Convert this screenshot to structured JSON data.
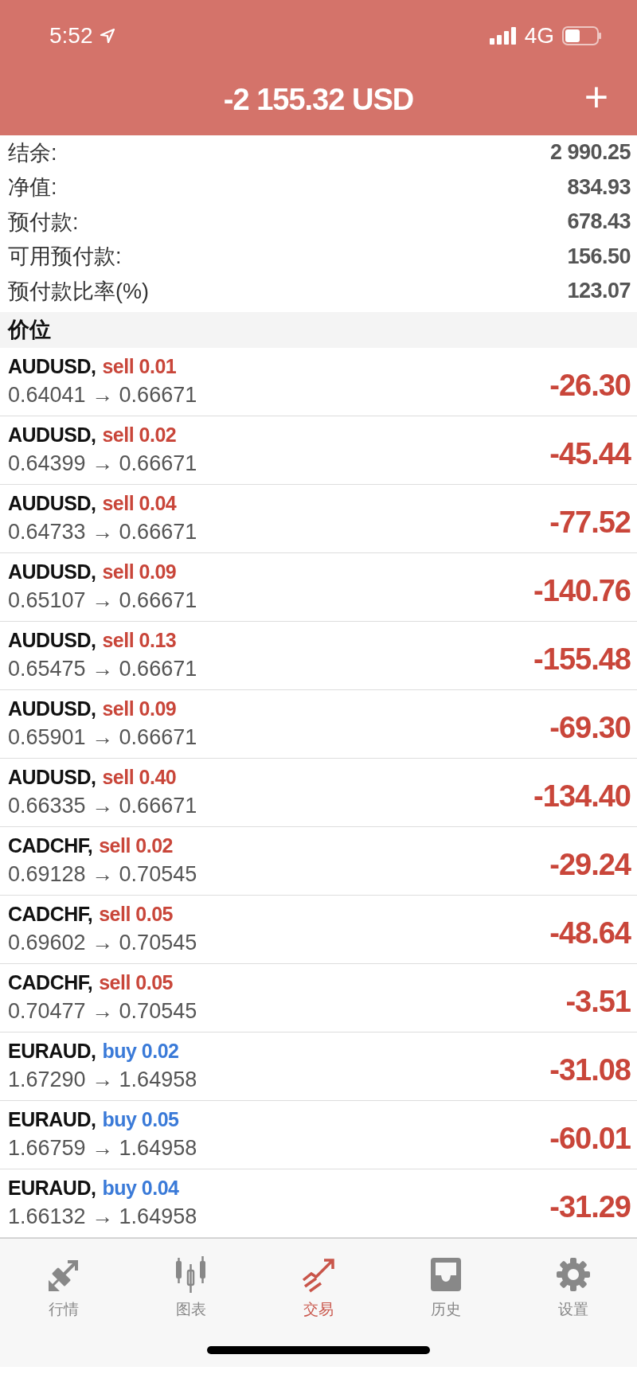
{
  "status_bar": {
    "time": "5:52",
    "network": "4G"
  },
  "header": {
    "title": "-2 155.32 USD",
    "add_button": "+"
  },
  "summary": [
    {
      "label": "结余:",
      "value": "2 990.25"
    },
    {
      "label": "净值:",
      "value": "834.93"
    },
    {
      "label": "预付款:",
      "value": "678.43"
    },
    {
      "label": "可用预付款:",
      "value": "156.50"
    },
    {
      "label": "预付款比率(%)",
      "value": "123.07"
    }
  ],
  "section_title": "价位",
  "positions": [
    {
      "symbol": "AUDUSD,",
      "kind": "sell",
      "order": "sell 0.01",
      "prices": "0.64041 → 0.66671",
      "profit": "-26.30"
    },
    {
      "symbol": "AUDUSD,",
      "kind": "sell",
      "order": "sell 0.02",
      "prices": "0.64399 → 0.66671",
      "profit": "-45.44"
    },
    {
      "symbol": "AUDUSD,",
      "kind": "sell",
      "order": "sell 0.04",
      "prices": "0.64733 → 0.66671",
      "profit": "-77.52"
    },
    {
      "symbol": "AUDUSD,",
      "kind": "sell",
      "order": "sell 0.09",
      "prices": "0.65107 → 0.66671",
      "profit": "-140.76"
    },
    {
      "symbol": "AUDUSD,",
      "kind": "sell",
      "order": "sell 0.13",
      "prices": "0.65475 → 0.66671",
      "profit": "-155.48"
    },
    {
      "symbol": "AUDUSD,",
      "kind": "sell",
      "order": "sell 0.09",
      "prices": "0.65901 → 0.66671",
      "profit": "-69.30"
    },
    {
      "symbol": "AUDUSD,",
      "kind": "sell",
      "order": "sell 0.40",
      "prices": "0.66335 → 0.66671",
      "profit": "-134.40"
    },
    {
      "symbol": "CADCHF,",
      "kind": "sell",
      "order": "sell 0.02",
      "prices": "0.69128 → 0.70545",
      "profit": "-29.24"
    },
    {
      "symbol": "CADCHF,",
      "kind": "sell",
      "order": "sell 0.05",
      "prices": "0.69602 → 0.70545",
      "profit": "-48.64"
    },
    {
      "symbol": "CADCHF,",
      "kind": "sell",
      "order": "sell 0.05",
      "prices": "0.70477 → 0.70545",
      "profit": "-3.51"
    },
    {
      "symbol": "EURAUD,",
      "kind": "buy",
      "order": "buy 0.02",
      "prices": "1.67290 → 1.64958",
      "profit": "-31.08"
    },
    {
      "symbol": "EURAUD,",
      "kind": "buy",
      "order": "buy 0.05",
      "prices": "1.66759 → 1.64958",
      "profit": "-60.01"
    },
    {
      "symbol": "EURAUD,",
      "kind": "buy",
      "order": "buy 0.04",
      "prices": "1.66132 → 1.64958",
      "profit": "-31.29"
    }
  ],
  "tab_bar": [
    {
      "label": "行情",
      "kind": "quotes",
      "selected": false
    },
    {
      "label": "图表",
      "kind": "chart",
      "selected": false
    },
    {
      "label": "交易",
      "kind": "trade",
      "selected": true
    },
    {
      "label": "历史",
      "kind": "history",
      "selected": false
    },
    {
      "label": "设置",
      "kind": "settings",
      "selected": false
    }
  ]
}
